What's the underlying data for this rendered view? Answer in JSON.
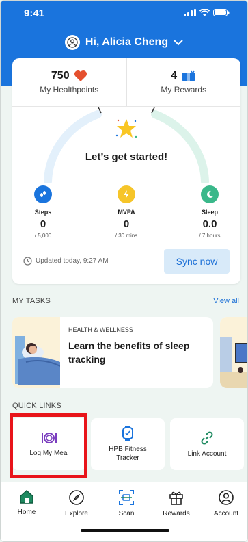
{
  "status_bar": {
    "time": "9:41"
  },
  "header": {
    "greeting": "Hi, Alicia Cheng"
  },
  "stats": {
    "healthpoints_value": "750",
    "healthpoints_label": "My Healthpoints",
    "rewards_value": "4",
    "rewards_label": "My Rewards"
  },
  "progress": {
    "title": "Let’s get started!",
    "metrics": [
      {
        "name": "Steps",
        "value": "0",
        "target": "/ 5,000",
        "color": "#1a74dd"
      },
      {
        "name": "MVPA",
        "value": "0",
        "target": "/ 30 mins",
        "color": "#f6c529"
      },
      {
        "name": "Sleep",
        "value": "0.0",
        "target": "/ 7 hours",
        "color": "#3ab88a"
      }
    ],
    "updated": "Updated today, 9:27 AM",
    "sync_label": "Sync now"
  },
  "tasks": {
    "section_title": "MY TASKS",
    "view_all": "View all",
    "card": {
      "category": "HEALTH & WELLNESS",
      "title": "Learn the benefits of sleep tracking"
    }
  },
  "quick_links": {
    "section_title": "QUICK LINKS",
    "items": [
      {
        "label": "Log My Meal",
        "icon": "meal-plate-icon"
      },
      {
        "label": "HPB Fitness Tracker",
        "icon": "fitness-watch-icon"
      },
      {
        "label": "Link Account",
        "icon": "link-icon"
      }
    ]
  },
  "nav": {
    "items": [
      {
        "label": "Home",
        "icon": "home-icon"
      },
      {
        "label": "Explore",
        "icon": "compass-icon"
      },
      {
        "label": "Scan",
        "icon": "scan-icon"
      },
      {
        "label": "Rewards",
        "icon": "gift-icon"
      },
      {
        "label": "Account",
        "icon": "account-icon"
      }
    ]
  },
  "colors": {
    "brand_blue": "#1a74dd",
    "highlight_red": "#e8141a",
    "home_green": "#1e8a60"
  }
}
